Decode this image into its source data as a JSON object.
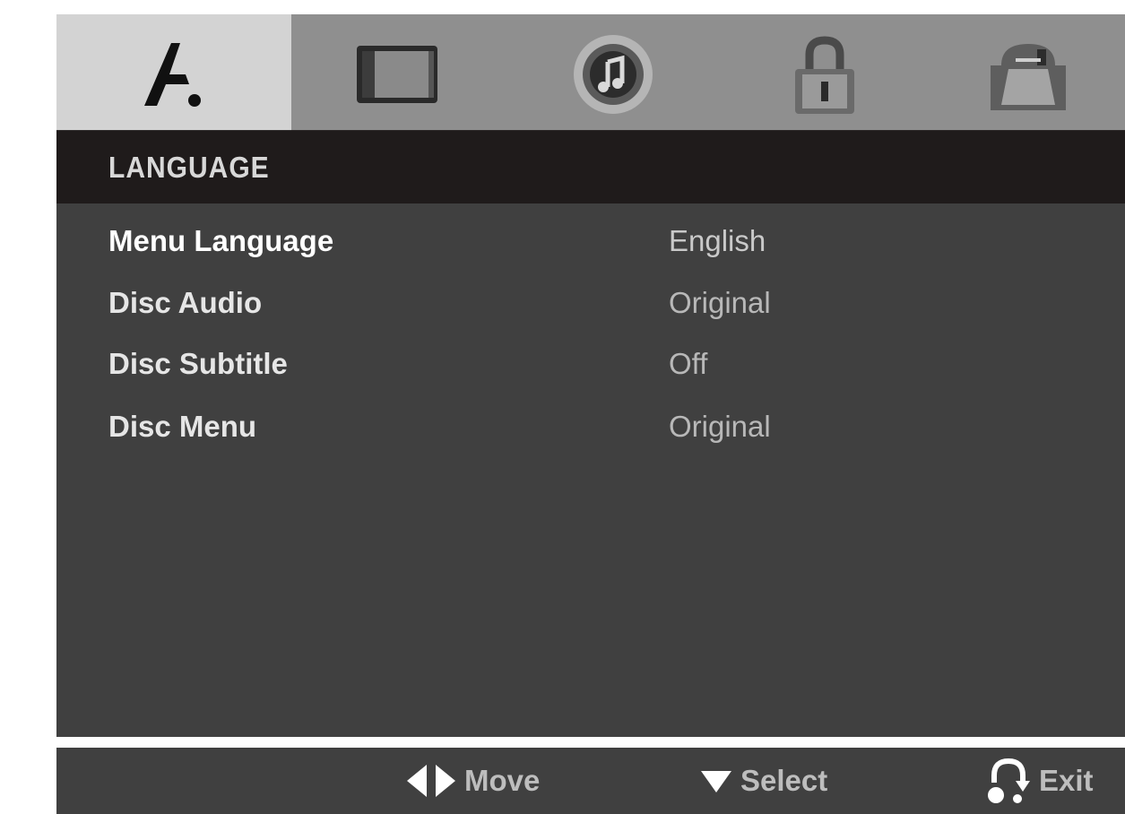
{
  "tabs": [
    {
      "name": "language-icon",
      "active": true
    },
    {
      "name": "display-icon",
      "active": false
    },
    {
      "name": "audio-icon",
      "active": false
    },
    {
      "name": "lock-icon",
      "active": false
    },
    {
      "name": "others-icon",
      "active": false
    }
  ],
  "section": {
    "title": "LANGUAGE"
  },
  "rows": [
    {
      "label": "Menu Language",
      "value": "English"
    },
    {
      "label": "Disc Audio",
      "value": "Original"
    },
    {
      "label": "Disc Subtitle",
      "value": "Off"
    },
    {
      "label": "Disc Menu",
      "value": "Original"
    }
  ],
  "footer": {
    "move_label": "Move",
    "select_label": "Select",
    "exit_label": "Exit"
  },
  "colors": {
    "tab_bar": "#8f8f8f",
    "tab_active": "#d3d3d3",
    "header": "#1f1b1b",
    "panel": "#404040"
  }
}
